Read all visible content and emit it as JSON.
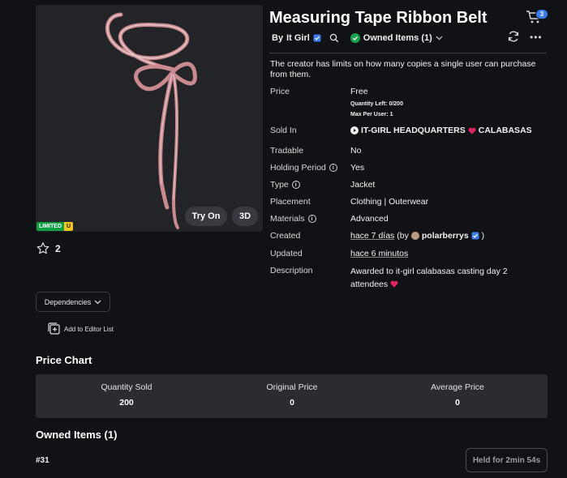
{
  "item": {
    "title": "Measuring Tape Ribbon Belt",
    "limited_badge": "LIMITED",
    "limited_suffix": "U",
    "try_on_label": "Try On",
    "view_3d_label": "3D",
    "favorite_count": "2",
    "dependencies_label": "Dependencies",
    "add_editor_label": "Add to Editor List"
  },
  "header": {
    "creator_prefix": "By",
    "creator_name": "It Girl",
    "owned_items_label": "Owned Items (1)",
    "cart_count": "3"
  },
  "notice": "The creator has limits on how many copies a single user can purchase from them.",
  "details": {
    "price_label": "Price",
    "price_value": "Free",
    "quantity_left": "Quantity Left: 0/200",
    "max_per_user": "Max Per User: 1",
    "sold_in_label": "Sold In",
    "sold_in_value_1": "IT-GIRL HEADQUARTERS",
    "sold_in_value_2": "CALABASAS",
    "tradable_label": "Tradable",
    "tradable_value": "No",
    "holding_label": "Holding Period",
    "holding_value": "Yes",
    "type_label": "Type",
    "type_value": "Jacket",
    "placement_label": "Placement",
    "placement_value": "Clothing | Outerwear",
    "materials_label": "Materials",
    "materials_value": "Advanced",
    "created_label": "Created",
    "created_value": "hace 7 días",
    "created_by_prefix": "(by",
    "created_by_user": "polarberrys",
    "created_by_suffix": ")",
    "updated_label": "Updated",
    "updated_value": "hace 6 minutos",
    "description_label": "Description",
    "description_value": "Awarded to it-girl calabasas casting day 2 attendees"
  },
  "price_chart": {
    "title": "Price Chart",
    "columns": [
      {
        "header": "Quantity Sold",
        "value": "200"
      },
      {
        "header": "Original Price",
        "value": "0"
      },
      {
        "header": "Average Price",
        "value": "0"
      }
    ]
  },
  "owned": {
    "title": "Owned Items (1)",
    "serial": "#31",
    "held_label": "Held for 2min 54s"
  },
  "colors": {
    "background": "#111216",
    "panel": "#2a2c30",
    "verified": "#3a7bf0",
    "owned_check": "#12a24a",
    "heart": "#e0245e"
  }
}
